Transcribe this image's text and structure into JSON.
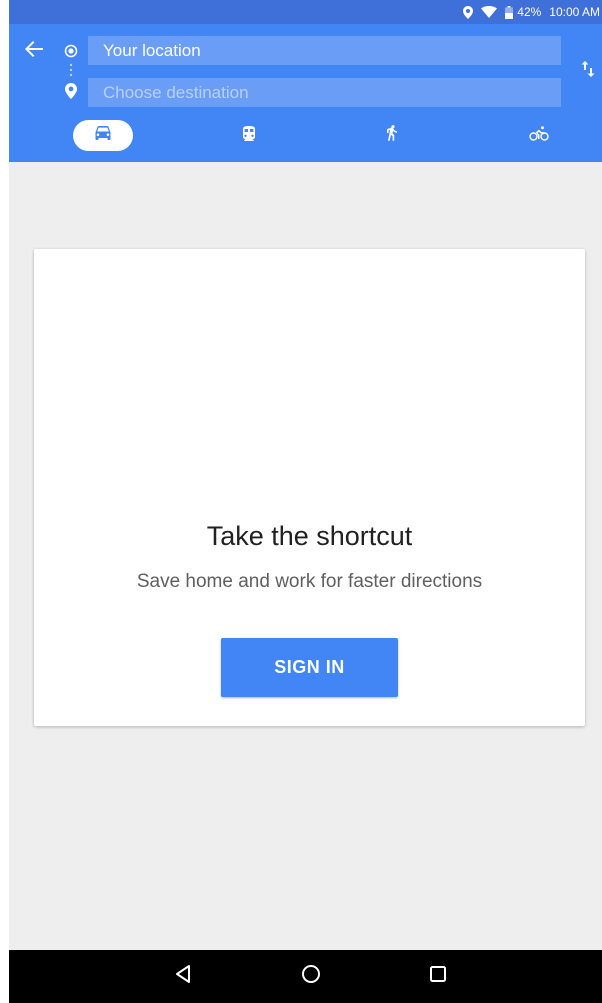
{
  "status_bar": {
    "battery": "42%",
    "time": "10:00 AM",
    "icons": [
      "location-icon",
      "wifi-icon",
      "battery-icon"
    ]
  },
  "directions": {
    "origin_value": "Your location",
    "destination_placeholder": "Choose destination",
    "modes": [
      {
        "name": "driving",
        "icon": "car-icon",
        "selected": true
      },
      {
        "name": "transit",
        "icon": "train-icon",
        "selected": false
      },
      {
        "name": "walking",
        "icon": "walk-icon",
        "selected": false
      },
      {
        "name": "cycling",
        "icon": "bike-icon",
        "selected": false
      }
    ]
  },
  "card": {
    "title": "Take the shortcut",
    "subtitle": "Save home and work for faster directions",
    "button_label": "SIGN IN"
  },
  "nav_bar": {
    "buttons": [
      "back-icon",
      "home-icon",
      "recents-icon"
    ]
  },
  "colors": {
    "header": "#4285f4",
    "status_bar": "#3f6fd8",
    "field": "#6a9df6",
    "background": "#eeeeee",
    "button": "#4285f4"
  }
}
